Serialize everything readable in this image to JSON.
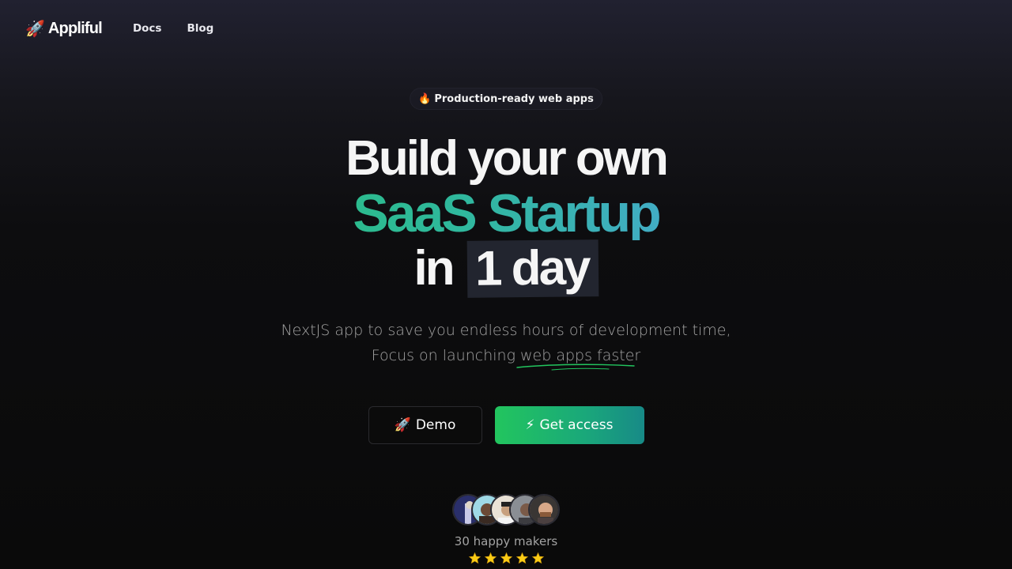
{
  "header": {
    "logo_emoji": "🚀",
    "logo_text": "Appliful",
    "nav": [
      {
        "label": "Docs"
      },
      {
        "label": "Blog"
      }
    ]
  },
  "badge": {
    "emoji": "🔥",
    "text": "Production-ready web apps"
  },
  "hero": {
    "line1": "Build your own",
    "line2": "SaaS Startup",
    "line3_prefix": "in",
    "line3_highlight": "1 day",
    "gradient_colors": [
      "#22c55e",
      "#60a5fa"
    ]
  },
  "subtitle": {
    "line1": "NextJS app to save you endless hours of development time,",
    "line2_prefix": "Focus on launching ",
    "line2_underlined": "web apps faster"
  },
  "buttons": {
    "demo_emoji": "🚀",
    "demo_label": "Demo",
    "access_emoji": "⚡",
    "access_label": "Get access"
  },
  "social_proof": {
    "avatar_count": 5,
    "makers_text": "30 happy makers",
    "rating_stars": 5
  },
  "colors": {
    "accent_green": "#22c55e",
    "accent_blue": "#60a5fa",
    "star_yellow": "#facc15",
    "background": "#0a0a0a"
  }
}
